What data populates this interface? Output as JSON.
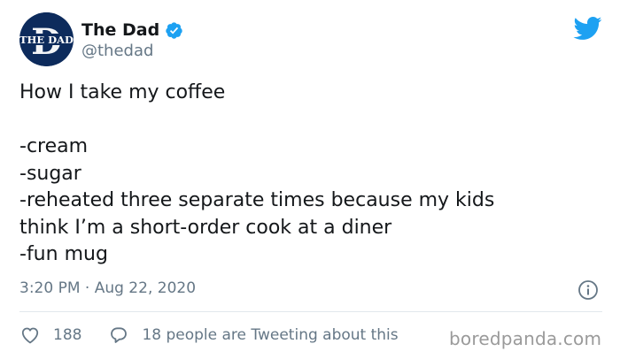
{
  "author": {
    "name": "The Dad",
    "handle": "@thedad",
    "verified": true,
    "avatar_text": "THE DAD",
    "avatar_letter": "D"
  },
  "tweet": {
    "lines": [
      "How I take my coffee",
      "",
      "-cream",
      "-sugar",
      "-reheated three separate times because my kids",
      "think I’m a short-order cook at a diner",
      "-fun mug"
    ],
    "timestamp": "3:20 PM · Aug 22, 2020"
  },
  "actions": {
    "like_count": "188",
    "reply_text": "18 people are Tweeting about this"
  },
  "watermark": "boredpanda.com",
  "colors": {
    "twitter_blue": "#1da1f2",
    "secondary_text": "#657786",
    "avatar_bg": "#0d2b5c"
  },
  "icons": {
    "brand": "twitter-bird-icon",
    "verified": "verified-badge-icon",
    "info": "info-icon",
    "like": "heart-icon",
    "reply": "speech-bubble-icon"
  }
}
